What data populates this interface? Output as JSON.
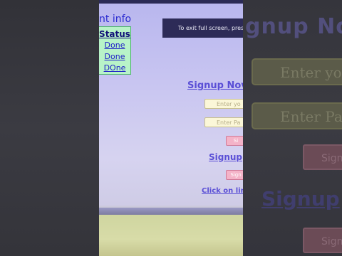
{
  "left_panel": {
    "heading": "nt info",
    "status_header": "Status",
    "statuses": [
      "Done",
      "Done",
      "DOne"
    ]
  },
  "fullscreen_hint": "To exit full screen, press",
  "form": {
    "title": "Signup Nov",
    "field_1_placeholder": "Enter yo",
    "field_2_placeholder": "Enter Pa",
    "button_1_label": "Si",
    "subheading": "Signup",
    "button_2_label": "Sign",
    "link": "Click on lin"
  },
  "zoomed": {
    "title": "gnup No",
    "field_1": "Enter yo",
    "field_2": "Enter Pa",
    "button_1": "Sign",
    "subheading": "Signup",
    "button_2": "Sign"
  }
}
